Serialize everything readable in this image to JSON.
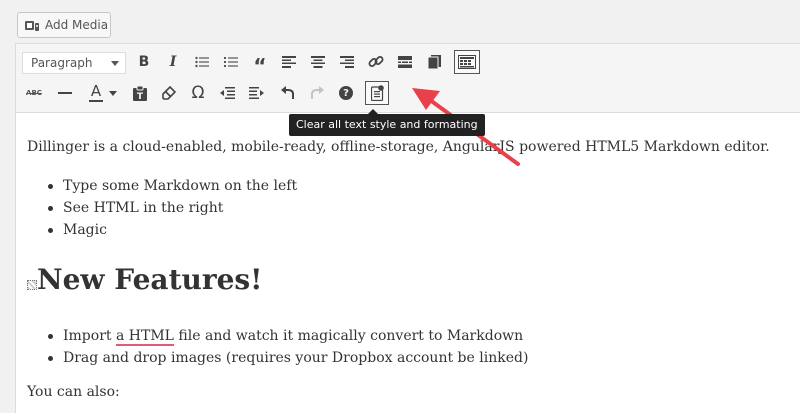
{
  "media": {
    "add_media_label": "Add Media"
  },
  "toolbar": {
    "format_select": "Paragraph",
    "row1_icons": [
      "bold-icon",
      "italic-icon",
      "bulleted-list-icon",
      "numbered-list-icon",
      "blockquote-icon",
      "align-left-icon",
      "align-center-icon",
      "align-right-icon",
      "link-icon",
      "read-more-icon",
      "fullscreen-icon",
      "toolbar-toggle-icon"
    ],
    "row2_icons": [
      "strikethrough-icon",
      "horizontal-line-icon",
      "text-color-icon",
      "paste-as-text-icon",
      "clear-formatting-icon",
      "special-character-icon",
      "outdent-icon",
      "indent-icon",
      "undo-icon",
      "redo-icon",
      "help-icon",
      "clear-all-formatting-icon"
    ],
    "bold_label": "B",
    "italic_label": "I",
    "strike_label": "ABC",
    "text_color_label": "A",
    "omega_label": "Ω",
    "quote_label": "“",
    "help_label": "?"
  },
  "tooltip": {
    "text": "Clear all text style and formating"
  },
  "content": {
    "intro": "Dillinger is a cloud-enabled, mobile-ready, offline-storage, AngularJS powered HTML5 Markdown editor.",
    "list1": [
      "Type some Markdown on the left",
      "See HTML in the right",
      "Magic"
    ],
    "heading": "New Features!",
    "list2_item1_pre": "Import ",
    "list2_item1_a": "a",
    "list2_item1_html": "HTML",
    "list2_item1_post": " file and watch it magically convert to Markdown",
    "list2_item2": "Drag and drop images (requires your Dropbox account be linked)",
    "closing": "You can also:"
  },
  "colors": {
    "accent_arrow": "#e8414a",
    "tooltip_bg": "#222222",
    "spell_underline": "#e05d6f"
  }
}
